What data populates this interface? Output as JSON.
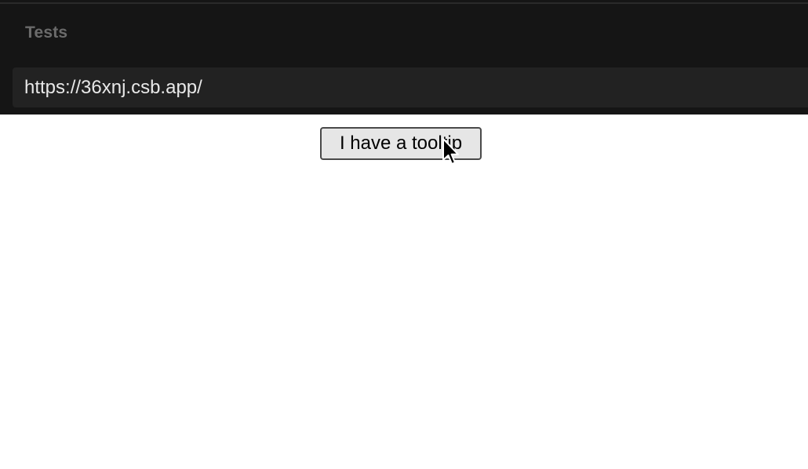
{
  "panel": {
    "title": "Tests"
  },
  "address_bar": {
    "url": "https://36xnj.csb.app/"
  },
  "preview": {
    "button_label": "I have a tooltip"
  },
  "icons": {
    "cursor": "mouse-pointer-icon"
  }
}
